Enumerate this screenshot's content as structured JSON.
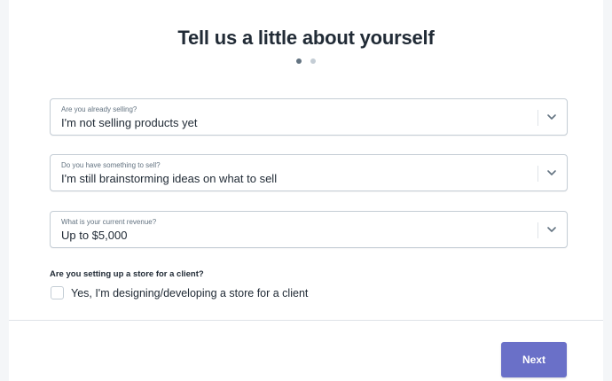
{
  "title": "Tell us a little about yourself",
  "steps": {
    "total": 2,
    "current": 1
  },
  "fields": [
    {
      "label": "Are you already selling?",
      "value": "I'm not selling products yet"
    },
    {
      "label": "Do you have something to sell?",
      "value": "I'm still brainstorming ideas on what to sell"
    },
    {
      "label": "What is your current revenue?",
      "value": "Up to $5,000"
    }
  ],
  "client_question": "Are you setting up a store for a client?",
  "client_checkbox": {
    "label": "Yes, I'm designing/developing a store for a client",
    "checked": false
  },
  "next_label": "Next",
  "colors": {
    "button": "#6a70c8",
    "text": "#212b36",
    "border": "#c4cdd5"
  }
}
